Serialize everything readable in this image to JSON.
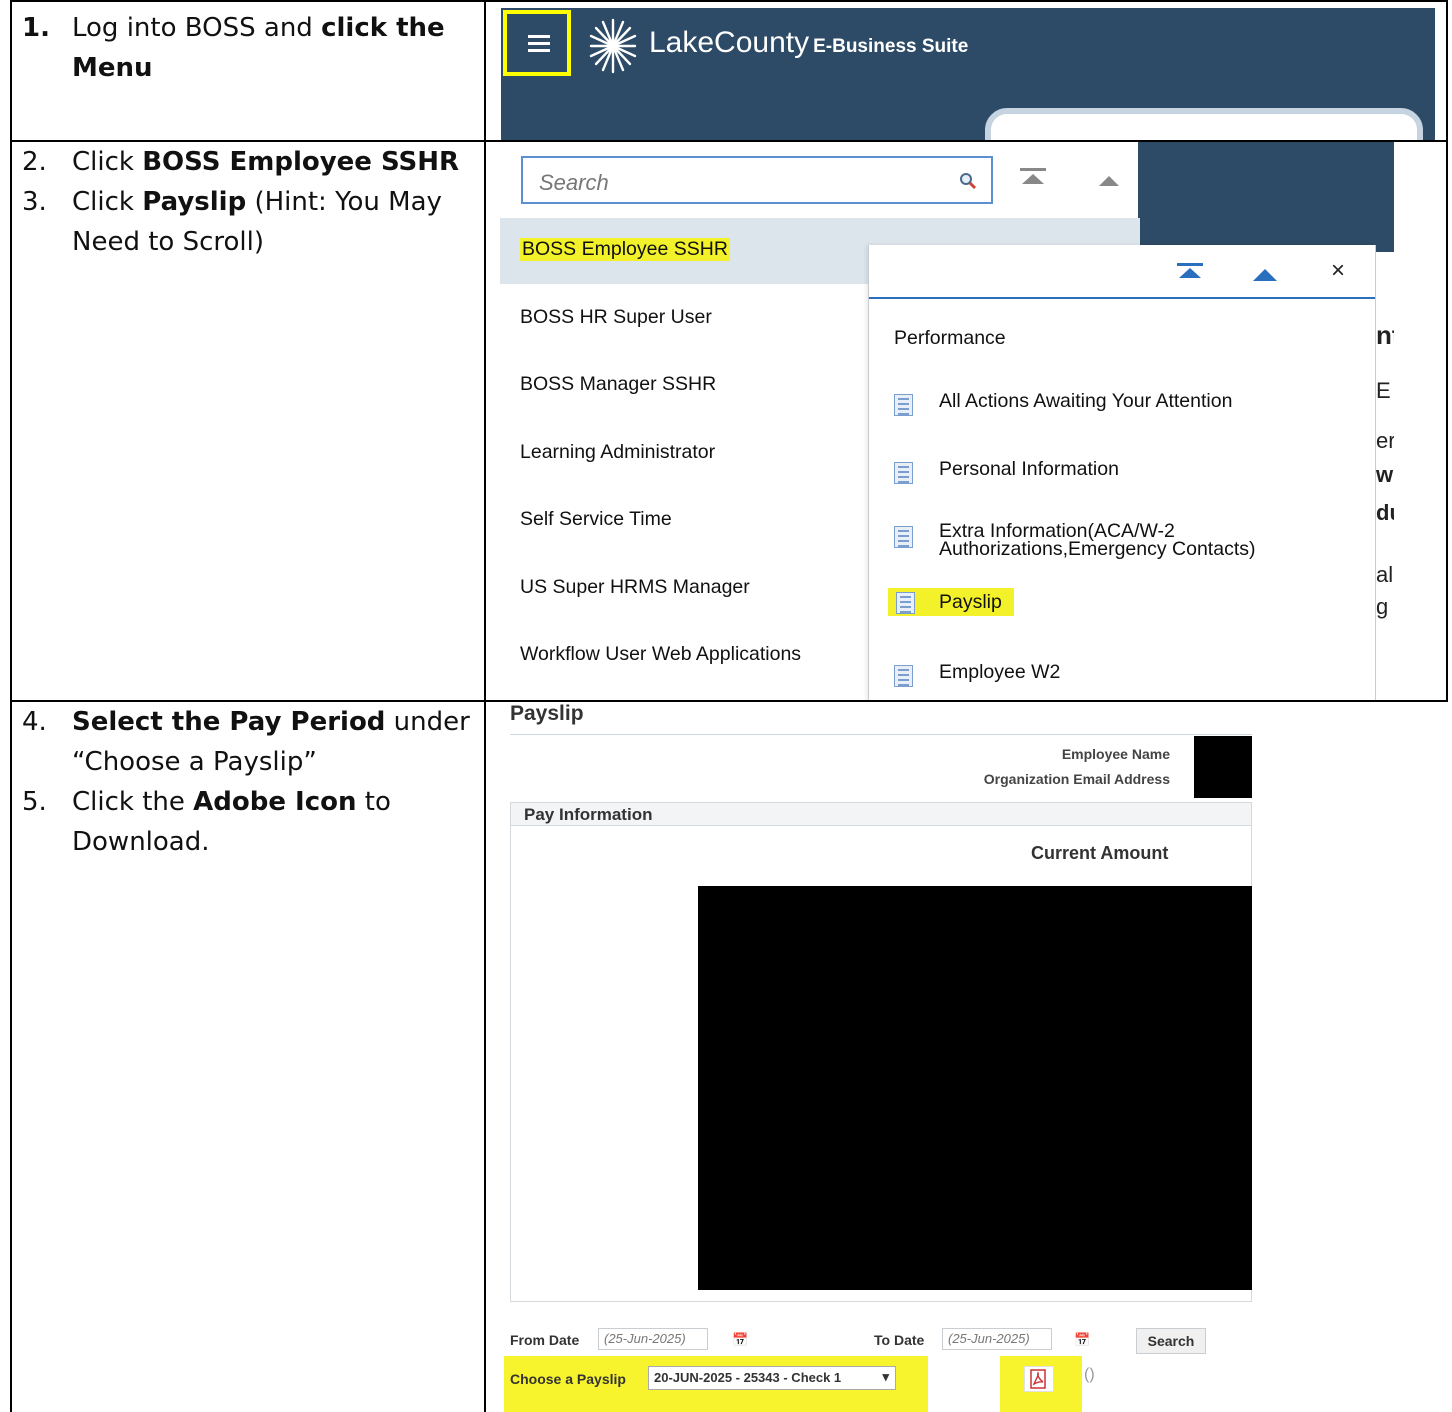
{
  "steps": {
    "s1_num": "1.",
    "s1_a": "Log into BOSS and ",
    "s1_b": "click the Menu",
    "s2_num": "2.",
    "s2_a": "Click ",
    "s2_b": "BOSS Employee SSHR",
    "s3_num": "3.",
    "s3_a": "Click ",
    "s3_b": "Payslip",
    "s3_c": " (Hint: You May Need to Scroll)",
    "s4_num": "4.",
    "s4_b": "Select the Pay Period",
    "s4_c": " under “Choose a Payslip”",
    "s5_num": "5.",
    "s5_a": "Click the ",
    "s5_b": "Adobe Icon",
    "s5_c": " to Download."
  },
  "header": {
    "brand": "LakeCounty",
    "suite": "E-Business Suite"
  },
  "navigator": {
    "search_placeholder": "Search",
    "left_items": [
      "BOSS Employee SSHR",
      "BOSS HR Super User",
      "BOSS Manager SSHR",
      "Learning Administrator",
      "Self Service Time",
      "US Super HRMS Manager",
      "Workflow User Web Applications"
    ],
    "flyout_heading": "Performance",
    "flyout_items": [
      "All Actions Awaiting Your Attention",
      "Personal Information",
      "Extra Information(ACA/W-2",
      "Authorizations,Emergency Contacts)",
      "Payslip",
      "Employee W2"
    ],
    "close_label": "×",
    "edge_fragments": [
      "nt",
      "E",
      "er",
      "w",
      "du",
      "ali",
      "g"
    ]
  },
  "payslip": {
    "title": "Payslip",
    "employee_name_label": "Employee Name",
    "org_email_label": "Organization Email Address",
    "pay_information": "Pay Information",
    "current_amount": "Current Amount",
    "from_date_label": "From Date",
    "from_date_value": "(25-Jun-2025)",
    "to_date_label": "To Date",
    "to_date_value": "(25-Jun-2025)",
    "search_button": "Search",
    "choose_label": "Choose a Payslip",
    "selected_payslip": "20-JUN-2025 - 25343 - Check 1"
  },
  "colors": {
    "header_bg": "#2d4a66",
    "highlight": "#f3f22a",
    "accent_blue": "#2a6fbd"
  }
}
